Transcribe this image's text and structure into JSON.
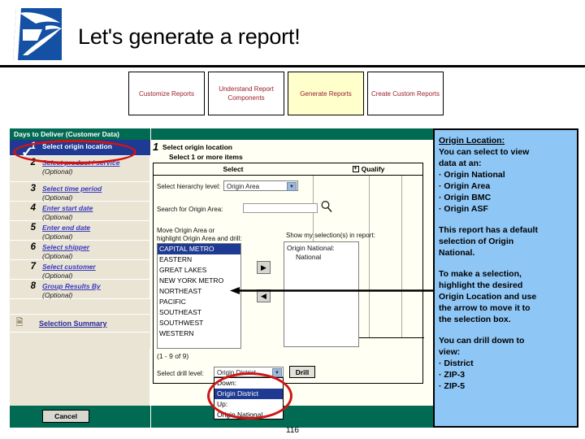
{
  "slide": {
    "title": "Let's generate a report!",
    "number": "116",
    "logo_icon": "usps-eagle-logo",
    "brand_blue": "#1450a3"
  },
  "nav_tabs": [
    {
      "label": "Customize Reports",
      "active": false
    },
    {
      "label": "Understand Report Components",
      "active": false
    },
    {
      "label": "Generate Reports",
      "active": true
    },
    {
      "label": "Create Custom Reports",
      "active": false
    }
  ],
  "wizard": {
    "header": "Days to Deliver (Customer Data)",
    "steps": [
      {
        "num": "1",
        "label": "Select origin location",
        "optional": "",
        "current": true,
        "check": "✓"
      },
      {
        "num": "2",
        "label": "Select product / service",
        "optional": "(Optional)",
        "current": false
      },
      {
        "num": "3",
        "label": "Select time period",
        "optional": "(Optional)",
        "current": false
      },
      {
        "num": "4",
        "label": "Enter start date",
        "optional": "(Optional)",
        "current": false
      },
      {
        "num": "5",
        "label": "Enter end date",
        "optional": "(Optional)",
        "current": false
      },
      {
        "num": "6",
        "label": "Select shipper",
        "optional": "(Optional)",
        "current": false
      },
      {
        "num": "7",
        "label": "Select customer",
        "optional": "(Optional)",
        "current": false
      },
      {
        "num": "8",
        "label": "Group Results By",
        "optional": "(Optional)",
        "current": false
      }
    ],
    "summary_icon": "document-summary-icon",
    "summary_label": "Selection Summary",
    "cancel_label": "Cancel"
  },
  "content": {
    "step_num": "1",
    "step_title": "Select origin location",
    "subtitle": "Select 1 or more items",
    "col_select": "Select",
    "col_qualify": "Qualify",
    "qualify_expand_icon": "plus-box-icon",
    "hierarchy_label": "Select hierarchy level:",
    "hierarchy_value": "Origin Area",
    "search_label": "Search for Origin Area:",
    "search_value": "",
    "search_placeholder": "",
    "search_icon": "magnifier-icon",
    "move_label_line1": "Move Origin Area or",
    "move_label_line2": "highlight Origin Area and drill:",
    "show_label": "Show my selection(s) in report:",
    "origin_list": [
      {
        "label": "CAPITAL METRO",
        "selected": true
      },
      {
        "label": "EASTERN",
        "selected": false
      },
      {
        "label": "GREAT LAKES",
        "selected": false
      },
      {
        "label": "NEW YORK METRO",
        "selected": false
      },
      {
        "label": "NORTHEAST",
        "selected": false
      },
      {
        "label": "PACIFIC",
        "selected": false
      },
      {
        "label": "SOUTHEAST",
        "selected": false
      },
      {
        "label": "SOUTHWEST",
        "selected": false
      },
      {
        "label": "WESTERN",
        "selected": false
      }
    ],
    "move_right_icon": "arrow-right-icon",
    "move_left_icon": "arrow-left-icon",
    "selection_title": "Origin National:",
    "selection_value": "National",
    "count_text": "(1 - 9 of 9)",
    "drill_label": "Select drill level:",
    "drill_value": "Origin District",
    "drill_button": "Drill",
    "drill_options": [
      {
        "label": "Down:",
        "selected": false
      },
      {
        "label": "Origin District",
        "selected": true
      },
      {
        "label": "Up:",
        "selected": false
      },
      {
        "label": "Origin National",
        "selected": false
      }
    ]
  },
  "info": {
    "heading": "Origin Location:",
    "intro": [
      "You can select to view",
      "data at an:"
    ],
    "bullets_1": [
      "Origin National",
      "Origin Area",
      "Origin BMC",
      "Origin ASF"
    ],
    "para_2": [
      "This report has a default",
      "selection of Origin",
      "National."
    ],
    "para_3": [
      "To make a selection,",
      "highlight the desired",
      "Origin Location and use",
      "the arrow to move it to",
      "the selection box."
    ],
    "para_4": [
      "You can drill down to",
      "view:"
    ],
    "bullets_2": [
      "District",
      "ZIP-3",
      "ZIP-5"
    ],
    "background": "#8ec6f5"
  },
  "annotations": {
    "ellipse_color": "#d01414",
    "step1_ellipse": "highlight-ellipse-step-1",
    "drill_ellipse": "highlight-ellipse-drill-dropdown",
    "pointer": "left-pointing-arrow"
  }
}
